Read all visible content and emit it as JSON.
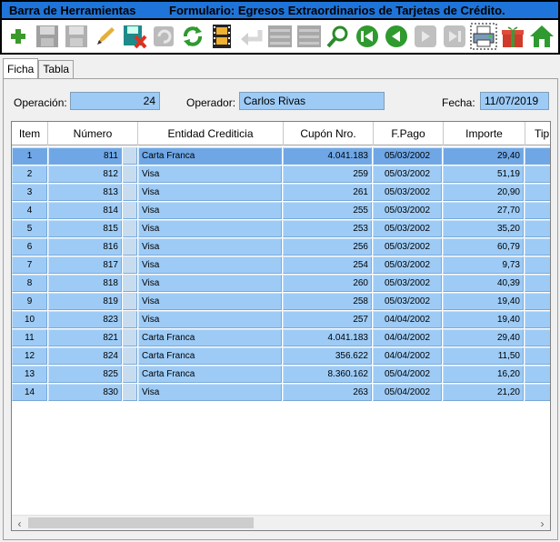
{
  "titlebar": {
    "left": "Barra de Herramientas",
    "right": "Formulario: Egresos Extraordinarios de Tarjetas de Crédito."
  },
  "toolbar": {
    "icons": [
      "add-icon",
      "save-icon",
      "save-disabled-icon",
      "edit-pencil-icon",
      "delete-save-icon",
      "undo-icon",
      "refresh-icon",
      "film-icon",
      "back-arrow-icon",
      "disabled-icon",
      "disabled-icon",
      "search-icon",
      "first-record-icon",
      "previous-record-icon",
      "next-record-icon",
      "last-record-icon",
      "print-icon",
      "gift-icon",
      "home-icon"
    ]
  },
  "tabs": [
    "Ficha",
    "Tabla"
  ],
  "form": {
    "operacion_label": "Operación:",
    "operacion_value": "24",
    "operador_label": "Operador:",
    "operador_value": "Carlos Rivas",
    "fecha_label": "Fecha:",
    "fecha_value": "11/07/2019"
  },
  "grid": {
    "headers": [
      "Item",
      "Número",
      "Entidad Crediticia",
      "Cupón Nro.",
      "F.Pago",
      "Importe",
      "Tip"
    ],
    "rows": [
      {
        "item": "1",
        "numero": "811",
        "entidad": "Carta Franca",
        "cupon": "4.041.183",
        "fpago": "05/03/2002",
        "importe": "29,40"
      },
      {
        "item": "2",
        "numero": "812",
        "entidad": "Visa",
        "cupon": "259",
        "fpago": "05/03/2002",
        "importe": "51,19"
      },
      {
        "item": "3",
        "numero": "813",
        "entidad": "Visa",
        "cupon": "261",
        "fpago": "05/03/2002",
        "importe": "20,90"
      },
      {
        "item": "4",
        "numero": "814",
        "entidad": "Visa",
        "cupon": "255",
        "fpago": "05/03/2002",
        "importe": "27,70"
      },
      {
        "item": "5",
        "numero": "815",
        "entidad": "Visa",
        "cupon": "253",
        "fpago": "05/03/2002",
        "importe": "35,20"
      },
      {
        "item": "6",
        "numero": "816",
        "entidad": "Visa",
        "cupon": "256",
        "fpago": "05/03/2002",
        "importe": "60,79"
      },
      {
        "item": "7",
        "numero": "817",
        "entidad": "Visa",
        "cupon": "254",
        "fpago": "05/03/2002",
        "importe": "9,73"
      },
      {
        "item": "8",
        "numero": "818",
        "entidad": "Visa",
        "cupon": "260",
        "fpago": "05/03/2002",
        "importe": "40,39"
      },
      {
        "item": "9",
        "numero": "819",
        "entidad": "Visa",
        "cupon": "258",
        "fpago": "05/03/2002",
        "importe": "19,40"
      },
      {
        "item": "10",
        "numero": "823",
        "entidad": "Visa",
        "cupon": "257",
        "fpago": "04/04/2002",
        "importe": "19,40"
      },
      {
        "item": "11",
        "numero": "821",
        "entidad": "Carta Franca",
        "cupon": "4.041.183",
        "fpago": "04/04/2002",
        "importe": "29,40"
      },
      {
        "item": "12",
        "numero": "824",
        "entidad": "Carta Franca",
        "cupon": "356.622",
        "fpago": "04/04/2002",
        "importe": "11,50"
      },
      {
        "item": "13",
        "numero": "825",
        "entidad": "Carta Franca",
        "cupon": "8.360.162",
        "fpago": "05/04/2002",
        "importe": "16,20"
      },
      {
        "item": "14",
        "numero": "830",
        "entidad": "Visa",
        "cupon": "263",
        "fpago": "05/04/2002",
        "importe": "21,20"
      }
    ],
    "selected_row": 1
  },
  "colors": {
    "titlebar": "#1e74d8",
    "cell": "#9dcbf6",
    "cell_selected": "#6fa7e6"
  }
}
